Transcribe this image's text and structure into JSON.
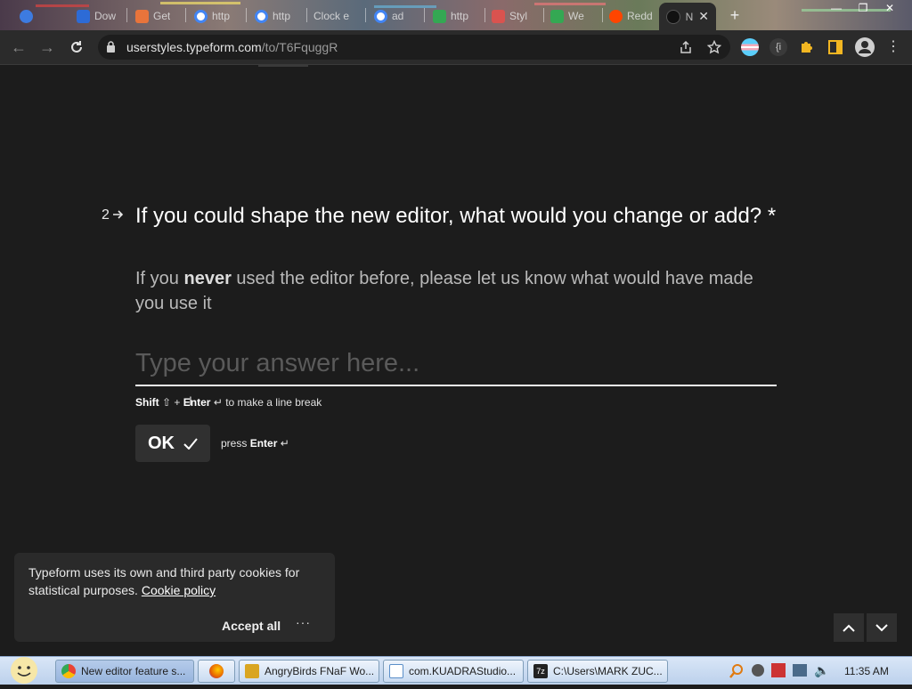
{
  "browser": {
    "tabs": [
      {
        "label": "Dow",
        "color": "#2d6bd6"
      },
      {
        "label": "Get",
        "color": "#e8743b"
      },
      {
        "label": "http",
        "color": "#4285f4"
      },
      {
        "label": "http",
        "color": "#4285f4"
      },
      {
        "label": "Clock e",
        "color": "#9a7b5a"
      },
      {
        "label": "ad",
        "color": "#4285f4"
      },
      {
        "label": "http",
        "color": "#34a853"
      },
      {
        "label": "Styl",
        "color": "#d9534f"
      },
      {
        "label": "We",
        "color": "#34a853"
      },
      {
        "label": "Redd",
        "color": "#ff4500"
      }
    ],
    "active_tab": {
      "label": "N"
    },
    "url_host": "userstyles.typeform.com",
    "url_path": "/to/T6FquggR"
  },
  "question": {
    "number": "2",
    "title": "If you could shape the new editor, what would you change or add? *",
    "subtitle_pre": "If you",
    "subtitle_bold": "never",
    "subtitle_post": "used the editor before, please let us know what would have made you use it",
    "placeholder": "Type your answer here...",
    "hint_shift": "Shift",
    "hint_plus": "+",
    "hint_enter": "Enter",
    "hint_rest": "to make a line break",
    "ok_label": "OK",
    "press_label": "press",
    "press_enter": "Enter"
  },
  "cookie": {
    "text": "Typeform uses its own and third party cookies for statistical purposes.",
    "link": "Cookie policy",
    "accept": "Accept all",
    "more": "···"
  },
  "taskbar": {
    "tasks": [
      {
        "label": "New editor feature s...",
        "color": "#4285f4",
        "active": true
      },
      {
        "label": "",
        "color": "#e66000",
        "active": false
      },
      {
        "label": "AngryBirds FNaF Wo...",
        "color": "#d9a521",
        "active": false
      },
      {
        "label": "com.KUADRAStudio...",
        "color": "#5b8fc9",
        "active": false
      },
      {
        "label": "C:\\Users\\MARK ZUC...",
        "color": "#333333",
        "active": false
      }
    ],
    "clock": "11:35 AM"
  },
  "colors": {
    "page_bg": "#1c1c1c",
    "toolbar_bg": "#2b2b2b",
    "accent_white": "#ffffff"
  }
}
